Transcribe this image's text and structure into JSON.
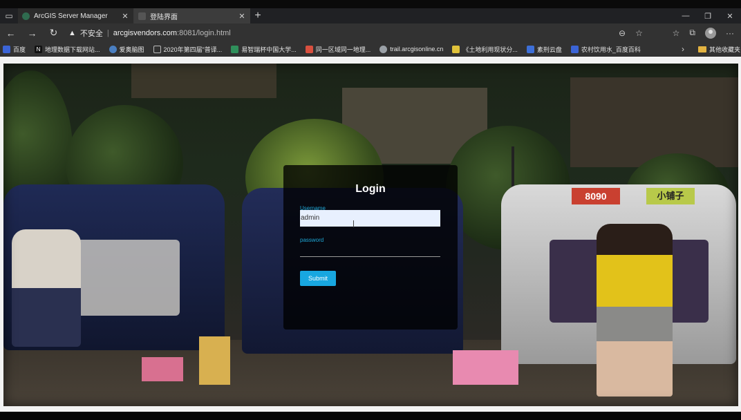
{
  "browser": {
    "tabs": [
      {
        "label": "ArcGIS Server Manager",
        "active": false
      },
      {
        "label": "登陆界面",
        "active": true
      }
    ],
    "address": {
      "security_label": "不安全",
      "url_host": "arcgisvendors.com",
      "url_rest": ":8081/login.html"
    },
    "bookmarks": [
      {
        "label": "百度",
        "color": "#3b64d6"
      },
      {
        "label": "地理数据下载网站...",
        "color": "#111111"
      },
      {
        "label": "爱奥脑图",
        "color": "#4a7fc1"
      },
      {
        "label": "2020年第四届\"普译...",
        "color": "#9aa0a6"
      },
      {
        "label": "易智瑞杯中国大学...",
        "color": "#2f8f5b"
      },
      {
        "label": "同一区域同一地理...",
        "color": "#d9503f"
      },
      {
        "label": "trail.arcgisonline.cn",
        "color": "#9aa0a6"
      },
      {
        "label": "《土地利用现状分...",
        "color": "#e0c23a"
      },
      {
        "label": "素刑云盘",
        "color": "#3d6fd8"
      },
      {
        "label": "农村饮用水_百度百科",
        "color": "#3b64d6"
      }
    ],
    "other_bookmarks": "其他收藏夹"
  },
  "login": {
    "title": "Login",
    "username_label": "Username",
    "username_value": "admin",
    "password_label": "password",
    "submit_label": "Submit"
  },
  "background": {
    "sign_left": "8090",
    "sign_right": "小铺子"
  }
}
